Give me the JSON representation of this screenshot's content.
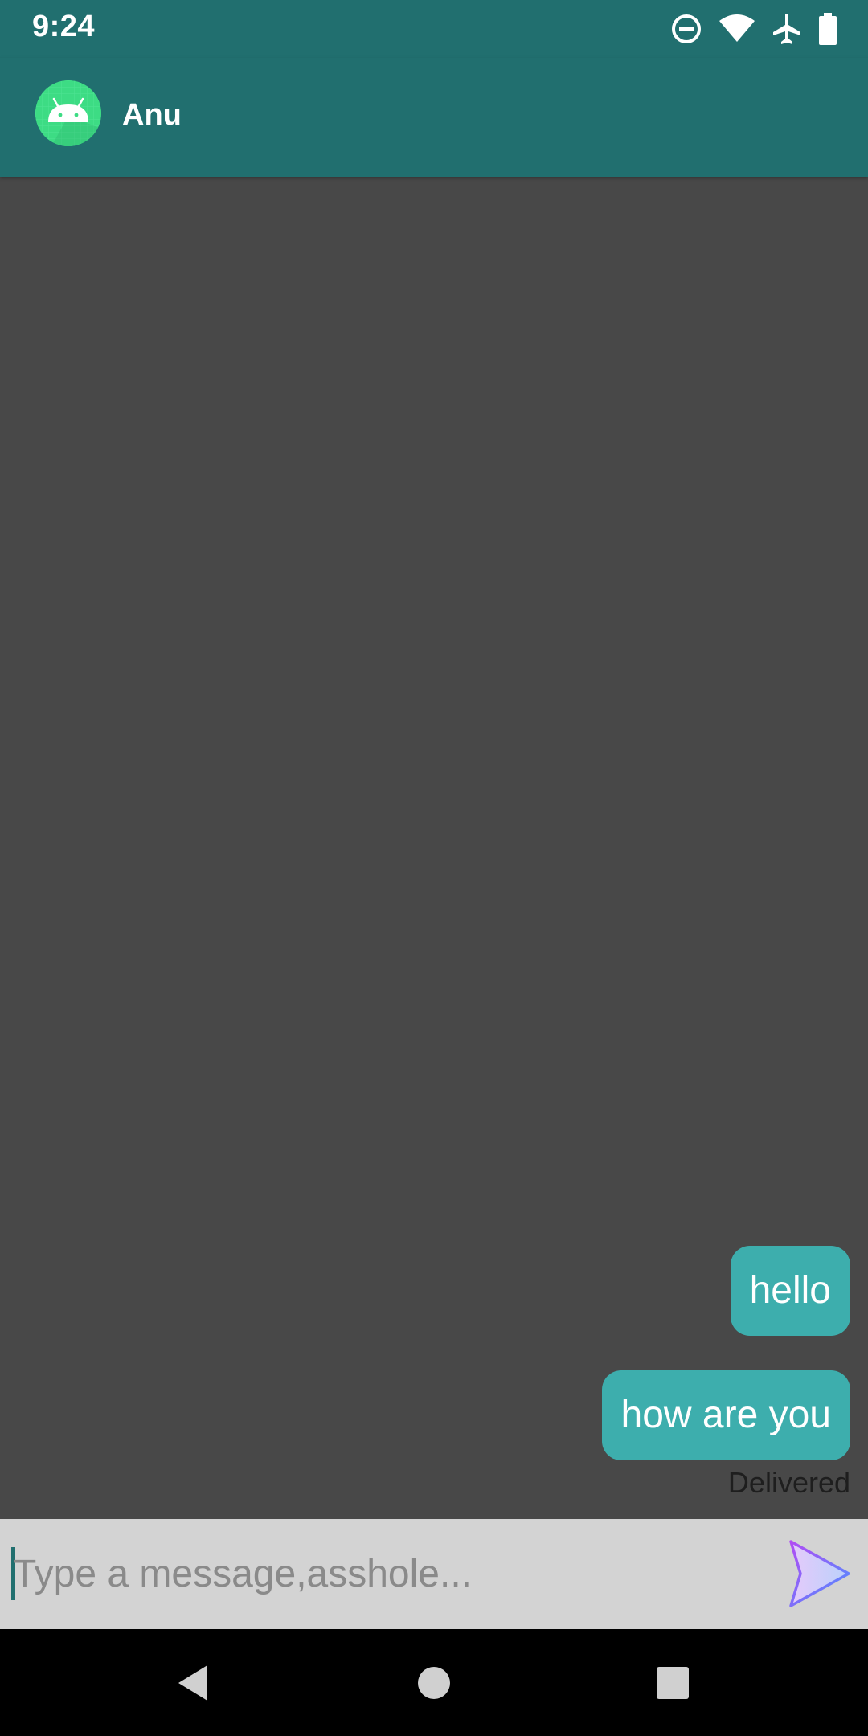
{
  "status_bar": {
    "time": "9:24",
    "icons": [
      "do-not-disturb-icon",
      "wifi-icon",
      "airplane-mode-icon",
      "battery-icon"
    ]
  },
  "header": {
    "contact_name": "Anu",
    "avatar_icon": "android-avatar-icon"
  },
  "messages": [
    {
      "text": "hello",
      "direction": "outgoing"
    },
    {
      "text": "how are you",
      "direction": "outgoing"
    }
  ],
  "delivery_status": "Delivered",
  "composer": {
    "placeholder": "Type a message,asshole...",
    "value": "",
    "send_icon": "send-paper-plane-icon"
  },
  "nav_bar": {
    "icons": [
      "back-icon",
      "home-icon",
      "recents-icon"
    ]
  },
  "colors": {
    "app_bar": "#216f6f",
    "chat_background": "#484848",
    "bubble": "#3daead",
    "input_bar": "#d3d3d3"
  }
}
